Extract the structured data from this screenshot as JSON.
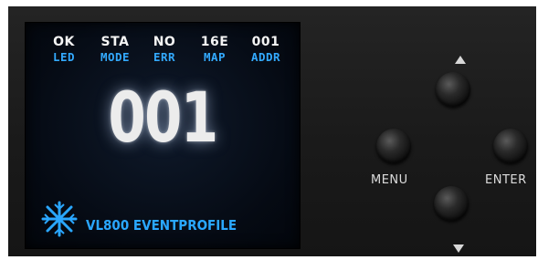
{
  "display": {
    "status": [
      {
        "value": "OK",
        "label": "LED"
      },
      {
        "value": "STA",
        "label": "MODE"
      },
      {
        "value": "NO",
        "label": "ERR"
      },
      {
        "value": "16E",
        "label": "MAP"
      },
      {
        "value": "001",
        "label": "ADDR"
      }
    ],
    "main_value": "001",
    "model": "VL800",
    "profile": "EVENTPROFILE",
    "text_color": "#2aa7ff"
  },
  "controls": {
    "up_icon": "triangle-up-icon",
    "down_icon": "triangle-down-icon",
    "menu_label": "MENU",
    "enter_label": "ENTER"
  }
}
